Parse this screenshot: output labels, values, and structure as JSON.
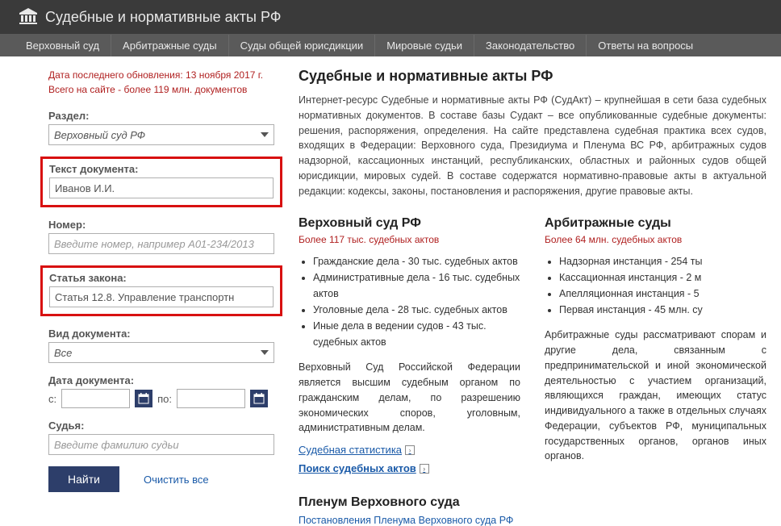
{
  "header": {
    "title": "Судебные и нормативные акты РФ"
  },
  "nav": [
    "Верховный суд",
    "Арбитражные суды",
    "Суды общей юрисдикции",
    "Мировые судьи",
    "Законодательство",
    "Ответы на вопросы"
  ],
  "update": {
    "line1": "Дата последнего обновления: 13 ноября 2017 г.",
    "line2": "Всего на сайте - более 119 млн. документов"
  },
  "form": {
    "section_label": "Раздел:",
    "section_value": "Верховный суд РФ",
    "text_label": "Текст документа:",
    "text_value": "Иванов И.И.",
    "number_label": "Номер:",
    "number_placeholder": "Введите номер, например А01-234/2013",
    "law_label": "Статья закона:",
    "law_value": "Статья 12.8. Управление транспортн",
    "type_label": "Вид документа:",
    "type_value": "Все",
    "date_label": "Дата документа:",
    "date_from": "с:",
    "date_to": "по:",
    "judge_label": "Судья:",
    "judge_placeholder": "Введите фамилию судьи",
    "search": "Найти",
    "clear": "Очистить все"
  },
  "main": {
    "title": "Судебные и нормативные акты РФ",
    "desc": "Интернет-ресурс Судебные и нормативные акты РФ (СудАкт) – крупнейшая в сети база судебных нормативных документов. В составе базы Судакт – все опубликованные судебные документы: решения, распоряжения, определения. На сайте представлена судебная практика всех судов, входящих в Федерации: Верховного суда, Президиума и Пленума ВС РФ, арбитражных судов надзорной, кассационных инстанций, республиканских, областных и районных судов общей юрисдикции, мировых судей. В составе содержатся нормативно-правовые акты в актуальной редакции: кодексы, законы, постановления и распоряжения, другие правовые акты.",
    "col1": {
      "title": "Верховный суд РФ",
      "sub": "Более 117 тыс. судебных актов",
      "items": [
        "Гражданские дела - 30 тыс. судебных актов",
        "Административные дела - 16 тыс. судебных актов",
        "Уголовные дела - 28 тыс. судебных актов",
        "Иные дела в ведении судов - 43 тыс. судебных актов"
      ],
      "p": "Верховный Суд Российской Федерации является высшим судебным органом по гражданским делам, по разрешению экономических споров, уголовным, административным делам.",
      "link1": "Судебная статистика",
      "link2": "Поиск судебных актов",
      "plenum_title": "Пленум Верховного суда",
      "plenum_link": "Постановления Пленума Верховного суда РФ"
    },
    "col2": {
      "title": "Арбитражные суды",
      "sub": "Более 64 млн. судебных актов",
      "items": [
        "Надзорная инстанция - 254 ты",
        "Кассационная инстанция - 2 м",
        "Апелляционная инстанция - 5",
        "Первая инстанция - 45 млн. су"
      ],
      "p": "Арбитражные суды рассматривают спорам и другие дела, связанным с предпринимательской и иной экономической деятельностью с участием организаций, являющихся граждан, имеющих статус индивидуального а также в отдельных случаях Федерации, субъектов РФ, муниципальных государственных органов, органов иных органов."
    }
  }
}
